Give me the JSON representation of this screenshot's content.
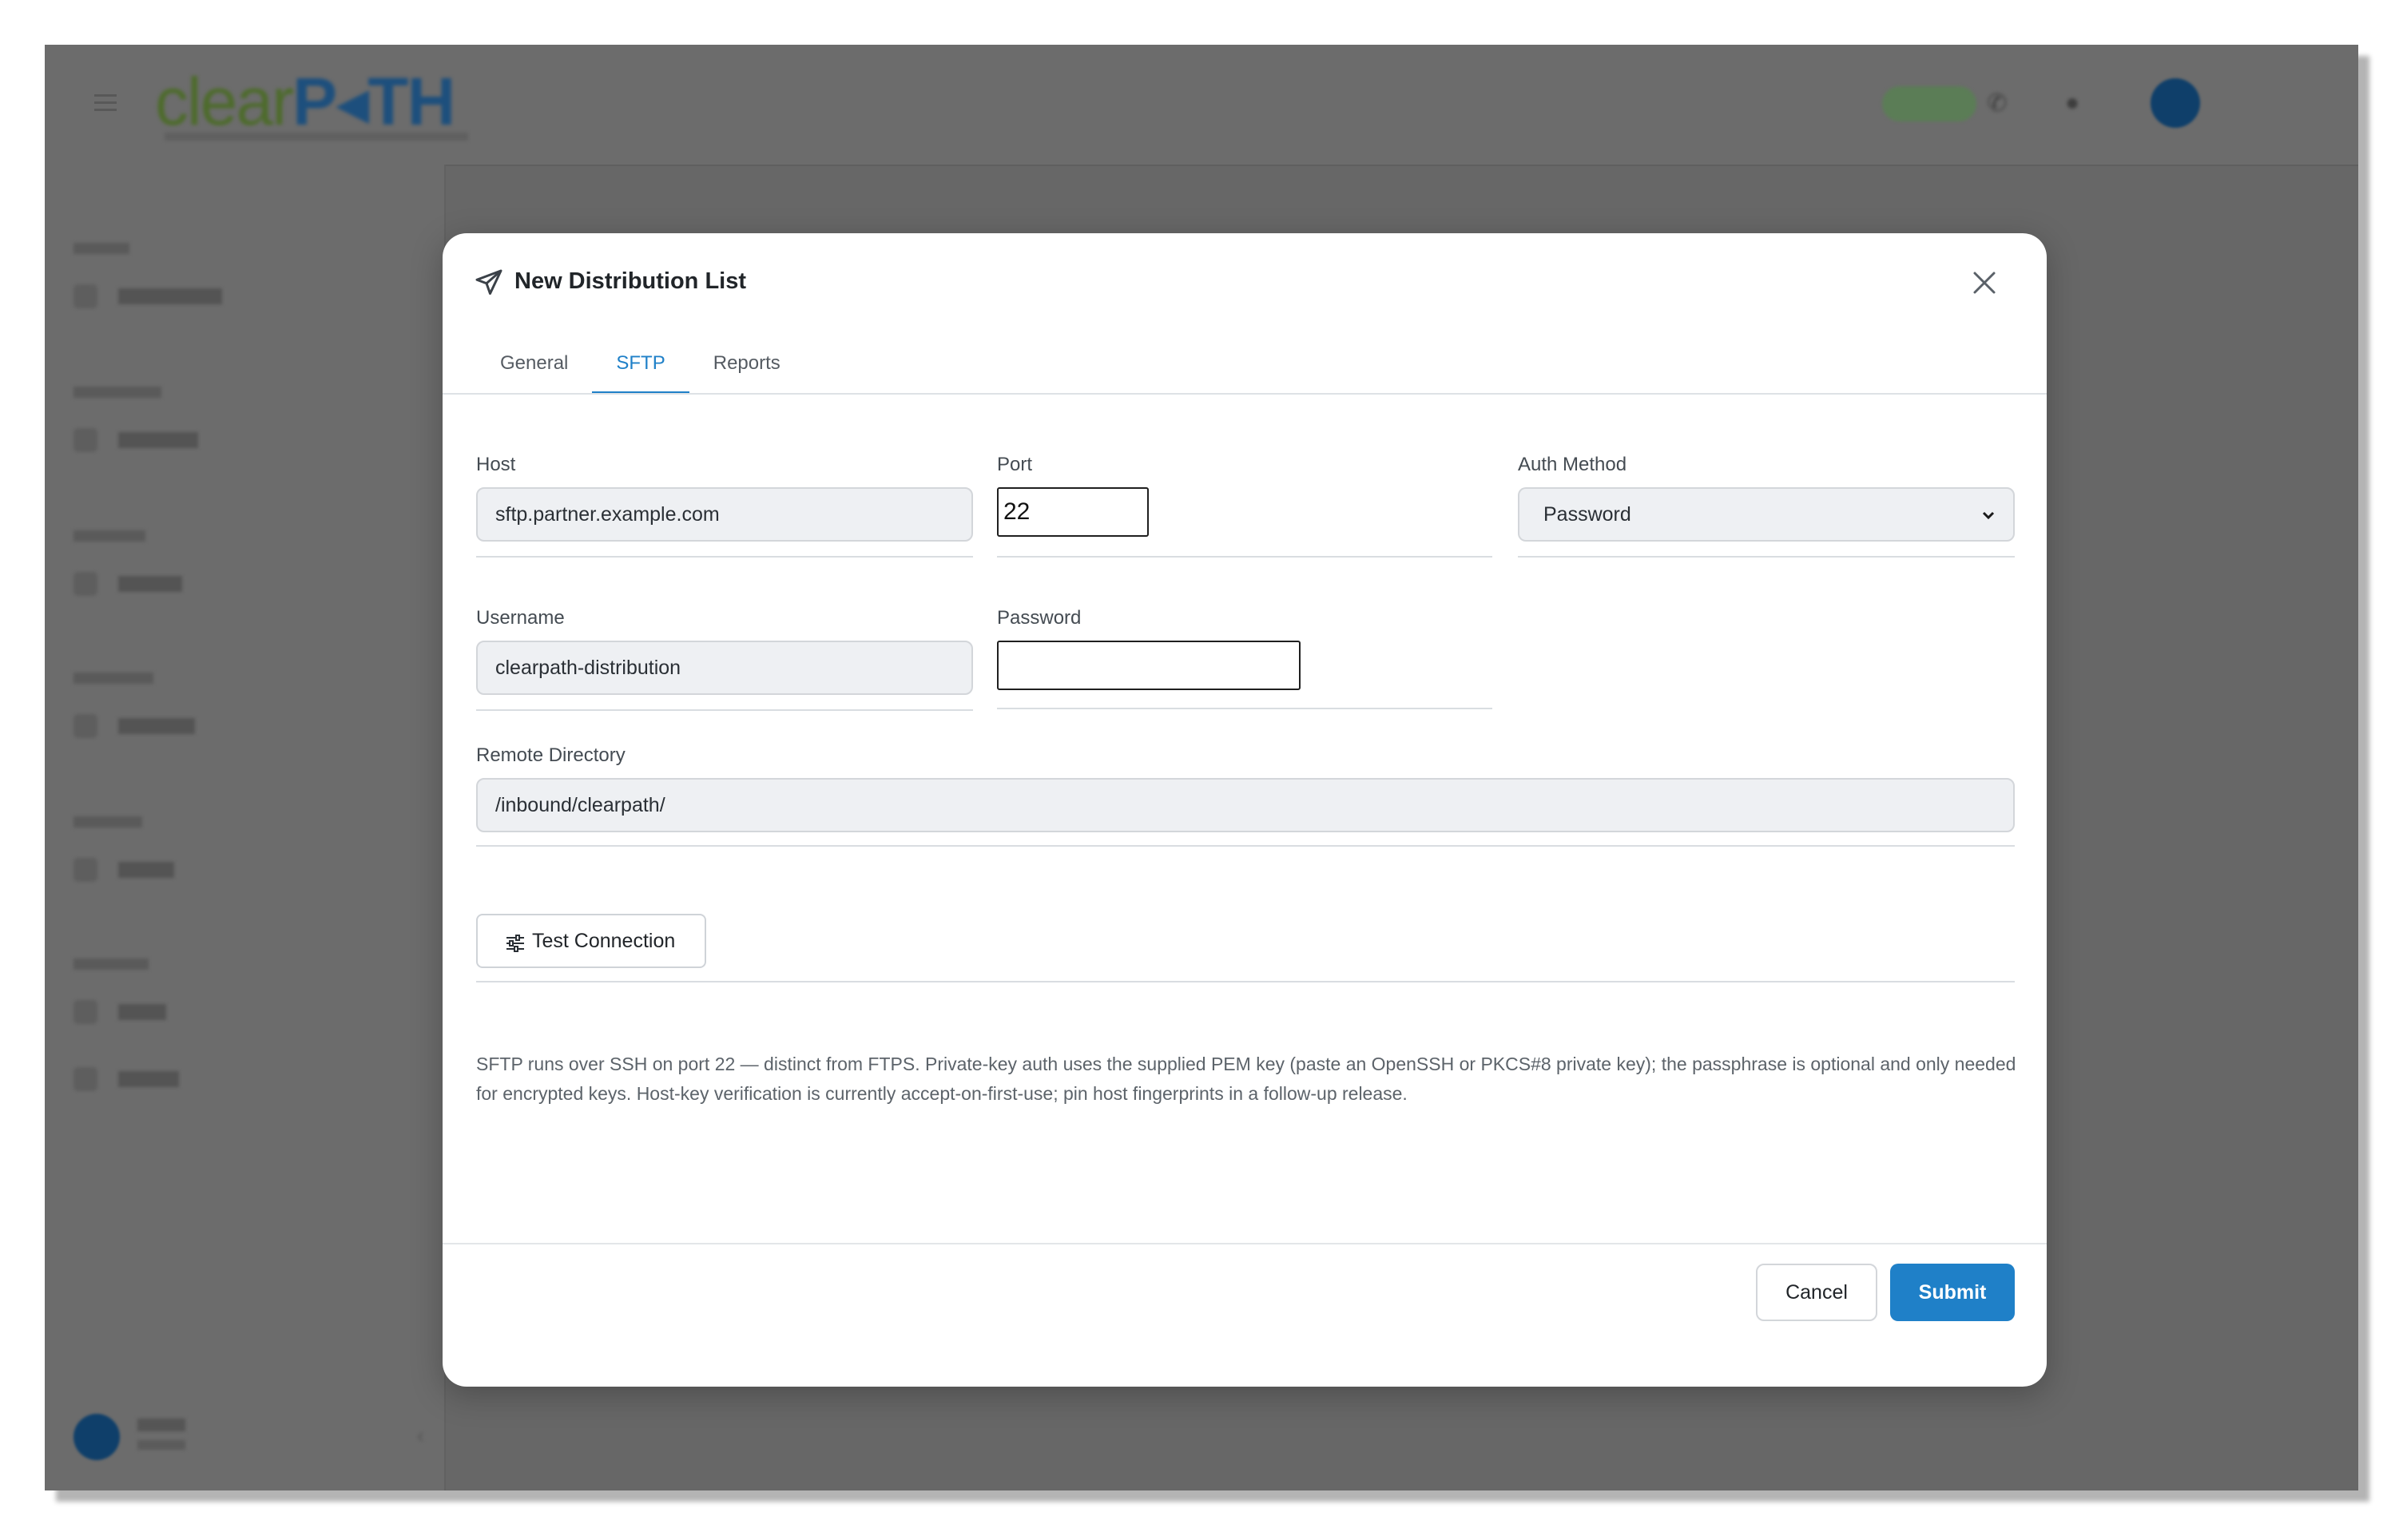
{
  "app": {
    "logo_part1": "clear",
    "logo_part2": "P◂TH"
  },
  "modal": {
    "title": "New Distribution List",
    "tabs": [
      {
        "label": "General",
        "active": false
      },
      {
        "label": "SFTP",
        "active": true
      },
      {
        "label": "Reports",
        "active": false
      }
    ],
    "fields": {
      "host": {
        "label": "Host",
        "value": "sftp.partner.example.com"
      },
      "port": {
        "label": "Port",
        "value": "22"
      },
      "auth_method": {
        "label": "Auth Method",
        "value": "Password"
      },
      "username": {
        "label": "Username",
        "value": "clearpath-distribution"
      },
      "password": {
        "label": "Password",
        "value": ""
      },
      "remote_directory": {
        "label": "Remote Directory",
        "value": "/inbound/clearpath/"
      }
    },
    "test_connection_label": "Test Connection",
    "help_text": "SFTP runs over SSH on port 22 — distinct from FTPS. Private-key auth uses the supplied PEM key (paste an OpenSSH or PKCS#8 private key); the passphrase is optional and only needed for encrypted keys. Host-key verification is currently accept-on-first-use; pin host fingerprints in a follow-up release.",
    "cancel_label": "Cancel",
    "submit_label": "Submit"
  },
  "colors": {
    "accent": "#1f80c8",
    "overlay": "#676767",
    "text": "#212529"
  }
}
